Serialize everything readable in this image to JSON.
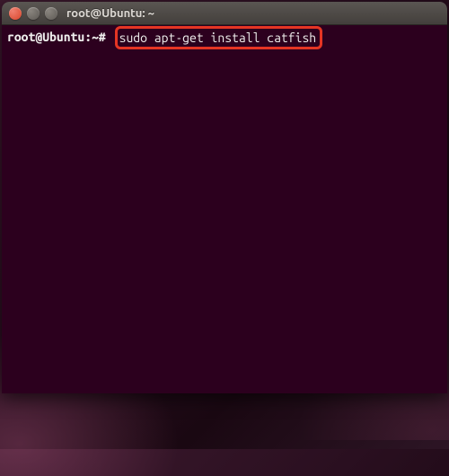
{
  "window": {
    "title": "root@Ubuntu: ~"
  },
  "terminal": {
    "prompt": "root@Ubuntu:~# ",
    "command": "sudo apt-get install catfish"
  },
  "highlight": {
    "color": "#e53524"
  }
}
